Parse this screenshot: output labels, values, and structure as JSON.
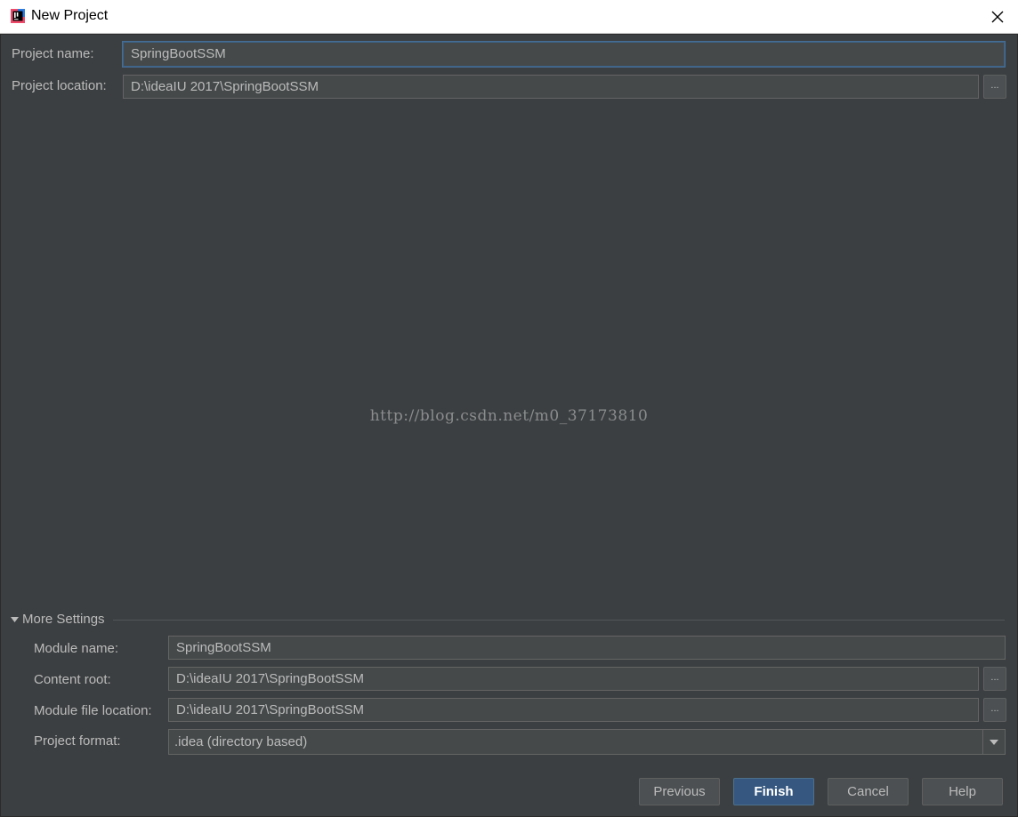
{
  "window": {
    "title": "New Project",
    "app_icon": "intellij-idea-icon",
    "close_icon": "close-icon"
  },
  "form": {
    "project_name_label": "Project name:",
    "project_name_value": "SpringBootSSM",
    "project_location_label": "Project location:",
    "project_location_value": "D:\\ideaIU 2017\\SpringBootSSM",
    "browse_label": "..."
  },
  "watermark": "http://blog.csdn.net/m0_37173810",
  "more_settings": {
    "toggle_label": "More Settings",
    "expanded": true,
    "module_name_label": "Module name:",
    "module_name_value": "SpringBootSSM",
    "content_root_label": "Content root:",
    "content_root_value": "D:\\ideaIU 2017\\SpringBootSSM",
    "module_file_location_label": "Module file location:",
    "module_file_location_value": "D:\\ideaIU 2017\\SpringBootSSM",
    "project_format_label": "Project format:",
    "project_format_value": ".idea (directory based)"
  },
  "buttons": {
    "previous": "Previous",
    "finish": "Finish",
    "cancel": "Cancel",
    "help": "Help"
  },
  "colors": {
    "background": "#3c3f41",
    "field_bg": "#45494a",
    "primary_button": "#365880",
    "text": "#bbbbbb"
  }
}
